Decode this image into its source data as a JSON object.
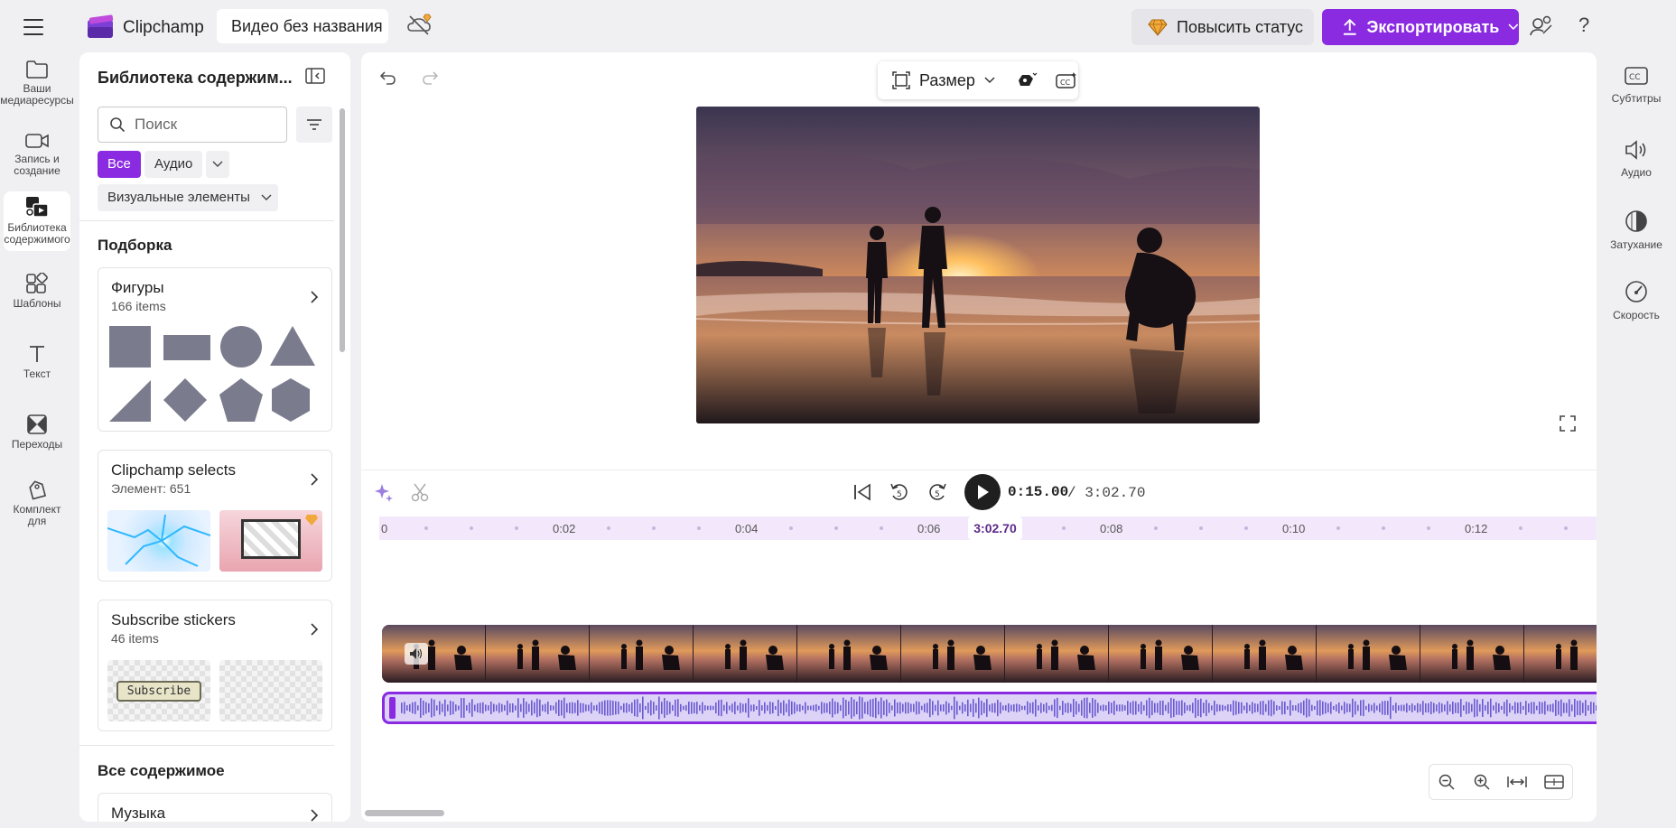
{
  "header": {
    "app_name": "Clipchamp",
    "project_title": "Видео без названия",
    "upgrade_label": "Повысить статус",
    "export_label": "Экспортировать",
    "help_label": "?"
  },
  "left_nav": [
    {
      "label": "Ваши медиаресурсы",
      "icon": "folder-icon"
    },
    {
      "label": "Запись и создание",
      "icon": "camera-icon"
    },
    {
      "label": "Библиотека содержимого",
      "icon": "library-icon",
      "active": true
    },
    {
      "label": "Шаблоны",
      "icon": "templates-icon"
    },
    {
      "label": "Текст",
      "icon": "text-icon"
    },
    {
      "label": "Переходы",
      "icon": "transitions-icon"
    },
    {
      "label": "Комплект для",
      "icon": "brand-kit-icon"
    }
  ],
  "library": {
    "title": "Библиотека содержим...",
    "search_placeholder": "Поиск",
    "filters": [
      "Все",
      "Аудио",
      "Визуальные элементы"
    ],
    "section_featured": "Подборка",
    "cards": [
      {
        "title": "Фигуры",
        "subtitle": "166 items"
      },
      {
        "title": "Clipchamp selects",
        "subtitle": "Элемент: 651"
      },
      {
        "title": "Subscribe stickers",
        "subtitle": "46 items",
        "sticker_text": "Subscribe"
      }
    ],
    "section_all": "Все содержимое",
    "music_label": "Музыка"
  },
  "preview": {
    "size_label": "Размер"
  },
  "timeline": {
    "current_time": "0:15.00",
    "total_time": "/ 3:02.70",
    "playhead_label": "3:02.70",
    "ticks": [
      "0",
      "0:02",
      "0:04",
      "0:06",
      "0:08",
      "0:10",
      "0:12"
    ],
    "skip_seconds": "5"
  },
  "right_nav": [
    {
      "label": "Субтитры",
      "icon": "captions-icon"
    },
    {
      "label": "Аудио",
      "icon": "speaker-icon"
    },
    {
      "label": "Затухание",
      "icon": "fade-icon"
    },
    {
      "label": "Скорость",
      "icon": "speed-icon"
    }
  ],
  "colors": {
    "accent": "#8a2be2",
    "background": "#f0f0f3",
    "panel": "#ffffff"
  }
}
